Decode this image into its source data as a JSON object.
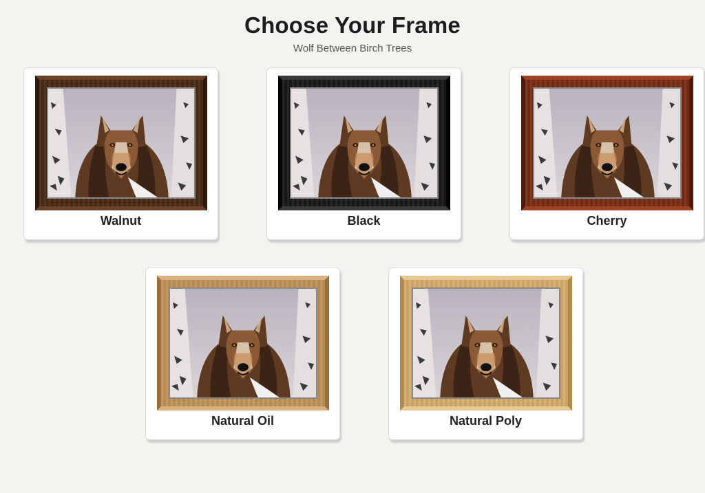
{
  "header": {
    "title": "Choose Your Frame",
    "subtitle": "Wolf Between Birch Trees"
  },
  "frames": [
    {
      "name": "Walnut",
      "color": "#4a2a18",
      "light": "#6b4128",
      "dark": "#2e170b"
    },
    {
      "name": "Black",
      "color": "#1a1a1a",
      "light": "#3a3a3a",
      "dark": "#050505"
    },
    {
      "name": "Cherry",
      "color": "#7a2d16",
      "light": "#9a4327",
      "dark": "#4f1a0a"
    },
    {
      "name": "Natural Oil",
      "color": "#c1935a",
      "light": "#d9b17e",
      "dark": "#9a6f3c"
    },
    {
      "name": "Natural Poly",
      "color": "#d4ad6c",
      "light": "#e7c994",
      "dark": "#b08a4c"
    }
  ],
  "artwork": {
    "subject": "wolf-between-birch-trees-image"
  }
}
